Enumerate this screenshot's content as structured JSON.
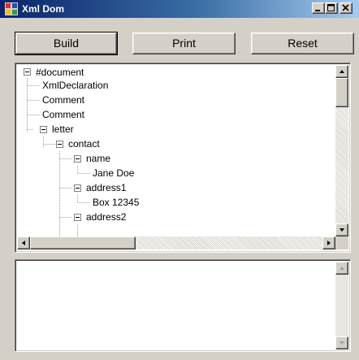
{
  "window": {
    "title": "Xml Dom"
  },
  "toolbar": {
    "build_label": "Build",
    "print_label": "Print",
    "reset_label": "Reset"
  },
  "tree": {
    "nodes": [
      {
        "label": "#document",
        "expanded": true
      },
      {
        "label": "XmlDeclaration"
      },
      {
        "label": "Comment"
      },
      {
        "label": "Comment"
      },
      {
        "label": "letter",
        "expanded": true
      },
      {
        "label": "contact",
        "expanded": true
      },
      {
        "label": "name",
        "expanded": true
      },
      {
        "label": "Jane Doe"
      },
      {
        "label": "address1",
        "expanded": true
      },
      {
        "label": "Box 12345"
      },
      {
        "label": "address2",
        "expanded": true
      }
    ]
  },
  "output": {
    "text": ""
  },
  "icons": {
    "app": "xml-dom-app-icon",
    "minimize": "minimize-icon",
    "maximize": "maximize-icon",
    "close": "close-icon"
  }
}
